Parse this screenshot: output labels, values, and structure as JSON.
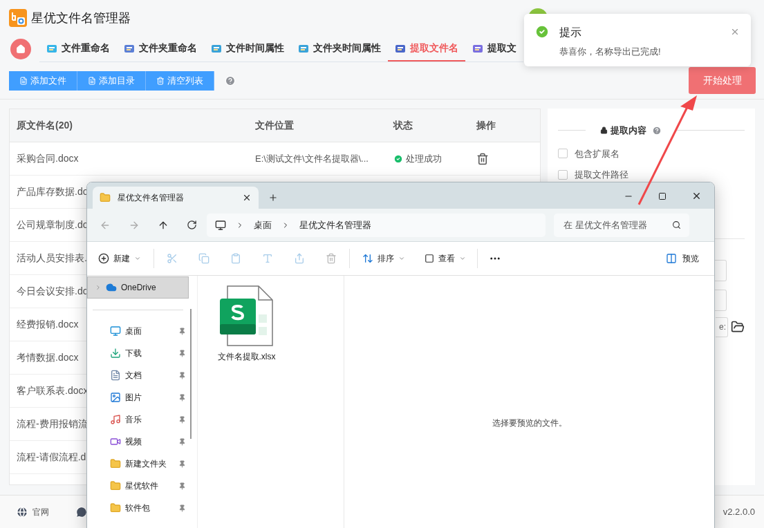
{
  "app": {
    "title": "星优文件名管理器",
    "tabs": [
      {
        "label": "文件重命名",
        "selected": false,
        "kind": "cards"
      },
      {
        "label": "文件夹重命名",
        "selected": false,
        "kind": "card"
      },
      {
        "label": "文件时间属性",
        "selected": false,
        "kind": "calendar"
      },
      {
        "label": "文件夹时间属性",
        "selected": false,
        "kind": "calendar"
      },
      {
        "label": "提取文件名",
        "selected": true,
        "kind": "stack"
      },
      {
        "label": "提取文",
        "selected": false,
        "kind": "doc"
      }
    ],
    "toolbar": [
      {
        "label": "添加文件",
        "kind": "file"
      },
      {
        "label": "添加目录",
        "kind": "file"
      },
      {
        "label": "清空列表",
        "kind": "trash"
      }
    ],
    "start_button": "开始处理",
    "table": {
      "columns": [
        "原文件名(20)",
        "文件位置",
        "状态",
        "操作"
      ],
      "rows": [
        {
          "name": "采购合同.docx",
          "location": "E:\\测试文件\\文件名提取器\\...",
          "status": "处理成功"
        },
        {
          "name": "产品库存数据.do"
        },
        {
          "name": "公司规章制度.do"
        },
        {
          "name": "活动人员安排表."
        },
        {
          "name": "今日会议安排.do"
        },
        {
          "name": "经费报销.docx"
        },
        {
          "name": "考情数据.docx"
        },
        {
          "name": "客户联系表.docx"
        },
        {
          "name": "流程-费用报销流"
        },
        {
          "name": "流程-请假流程.d"
        }
      ]
    },
    "panel": {
      "title": "提取内容",
      "options": [
        {
          "label": "包含扩展名",
          "checked": false
        },
        {
          "label": "提取文件路径",
          "checked": false
        }
      ],
      "field_value": "e:"
    },
    "footer": {
      "link": "官网",
      "version": "v2.2.0.0"
    }
  },
  "toast": {
    "title": "提示",
    "message": "恭喜你，名称导出已完成!"
  },
  "explorer": {
    "tab_title": "星优文件名管理器",
    "breadcrumb": [
      "桌面",
      "星优文件名管理器"
    ],
    "search_placeholder": "在 星优文件名管理器",
    "toolbar": {
      "new": "新建",
      "sort": "排序",
      "view": "查看",
      "preview": "预览"
    },
    "nav": [
      {
        "label": "OneDrive",
        "kind": "cloud",
        "selected": true
      },
      {
        "label": "桌面",
        "kind": "desktop",
        "selected": false
      },
      {
        "label": "下载",
        "kind": "download",
        "selected": false
      },
      {
        "label": "文档",
        "kind": "document",
        "selected": false
      },
      {
        "label": "图片",
        "kind": "picture",
        "selected": false
      },
      {
        "label": "音乐",
        "kind": "music",
        "selected": false
      },
      {
        "label": "视频",
        "kind": "video",
        "selected": false
      },
      {
        "label": "新建文件夹",
        "kind": "folder",
        "selected": false
      },
      {
        "label": "星优软件",
        "kind": "folder",
        "selected": false
      },
      {
        "label": "软件包",
        "kind": "folder",
        "selected": false
      }
    ],
    "files": [
      {
        "name": "文件名提取.xlsx"
      }
    ],
    "preview_hint": "选择要预览的文件。"
  }
}
